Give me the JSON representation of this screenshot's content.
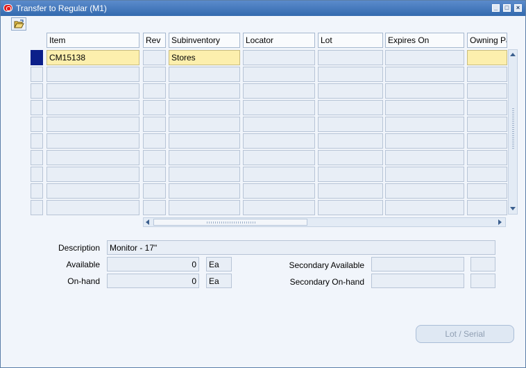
{
  "window": {
    "title": "Transfer to Regular (M1)",
    "controls": [
      "minimize",
      "maximize",
      "close"
    ]
  },
  "toolbar": {
    "open_icon": "folder-open-icon"
  },
  "table": {
    "columns": [
      "Item",
      "Rev",
      "Subinventory",
      "Locator",
      "Lot",
      "Expires On",
      "Owning Party"
    ],
    "rows": [
      [
        "CM15138",
        "",
        "Stores",
        "",
        "",
        "",
        ""
      ],
      [
        "",
        "",
        "",
        "",
        "",
        "",
        ""
      ],
      [
        "",
        "",
        "",
        "",
        "",
        "",
        ""
      ],
      [
        "",
        "",
        "",
        "",
        "",
        "",
        ""
      ],
      [
        "",
        "",
        "",
        "",
        "",
        "",
        ""
      ],
      [
        "",
        "",
        "",
        "",
        "",
        "",
        ""
      ],
      [
        "",
        "",
        "",
        "",
        "",
        "",
        ""
      ],
      [
        "",
        "",
        "",
        "",
        "",
        "",
        ""
      ],
      [
        "",
        "",
        "",
        "",
        "",
        "",
        ""
      ],
      [
        "",
        "",
        "",
        "",
        "",
        "",
        ""
      ]
    ],
    "selected_row": 0
  },
  "details": {
    "description_label": "Description",
    "description_value": "Monitor - 17\"",
    "available_label": "Available",
    "available_value": "0",
    "available_uom": "Ea",
    "onhand_label": "On-hand",
    "onhand_value": "0",
    "onhand_uom": "Ea",
    "secondary_available_label": "Secondary Available",
    "secondary_available_value": "",
    "secondary_available_uom": "",
    "secondary_onhand_label": "Secondary On-hand",
    "secondary_onhand_value": "",
    "secondary_onhand_uom": ""
  },
  "buttons": {
    "lot_serial": "Lot / Serial"
  },
  "colors": {
    "title_bar": "#3f73b6",
    "selected_cell": "#fcefad",
    "row_indicator": "#0b1f8a"
  }
}
